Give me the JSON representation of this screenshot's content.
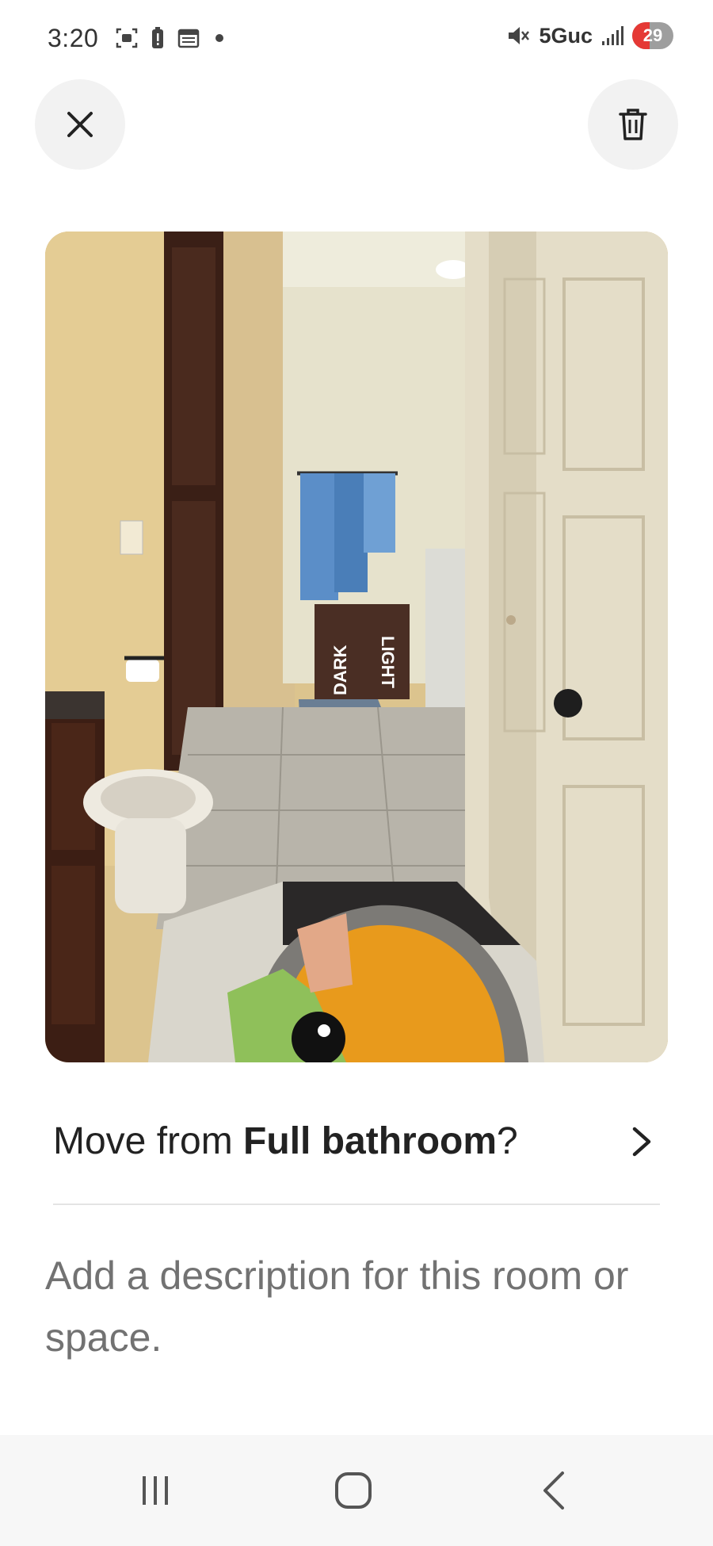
{
  "status_bar": {
    "time": "3:20",
    "network": "5Guc",
    "battery_level": "29",
    "left_icons": [
      "screenshot-icon",
      "battery-alert-icon",
      "calendar-icon",
      "dot-icon"
    ],
    "right_icons": [
      "mute-icon",
      "signal-icon",
      "battery-icon"
    ]
  },
  "toolbar": {
    "close_icon": "close-icon",
    "delete_icon": "trash-icon"
  },
  "photo": {
    "laundry_hamper_text": [
      "DARK",
      "LIGHT"
    ]
  },
  "move_row": {
    "prefix": "Move from ",
    "room": "Full bathroom",
    "suffix": "?"
  },
  "description": {
    "placeholder": "Add a description for this room or space."
  },
  "nav_bar": {
    "icons": [
      "recents-icon",
      "home-icon",
      "back-icon"
    ]
  },
  "colors": {
    "accent_battery_low": "#e53935",
    "text_primary": "#222222",
    "text_placeholder": "#727272"
  }
}
